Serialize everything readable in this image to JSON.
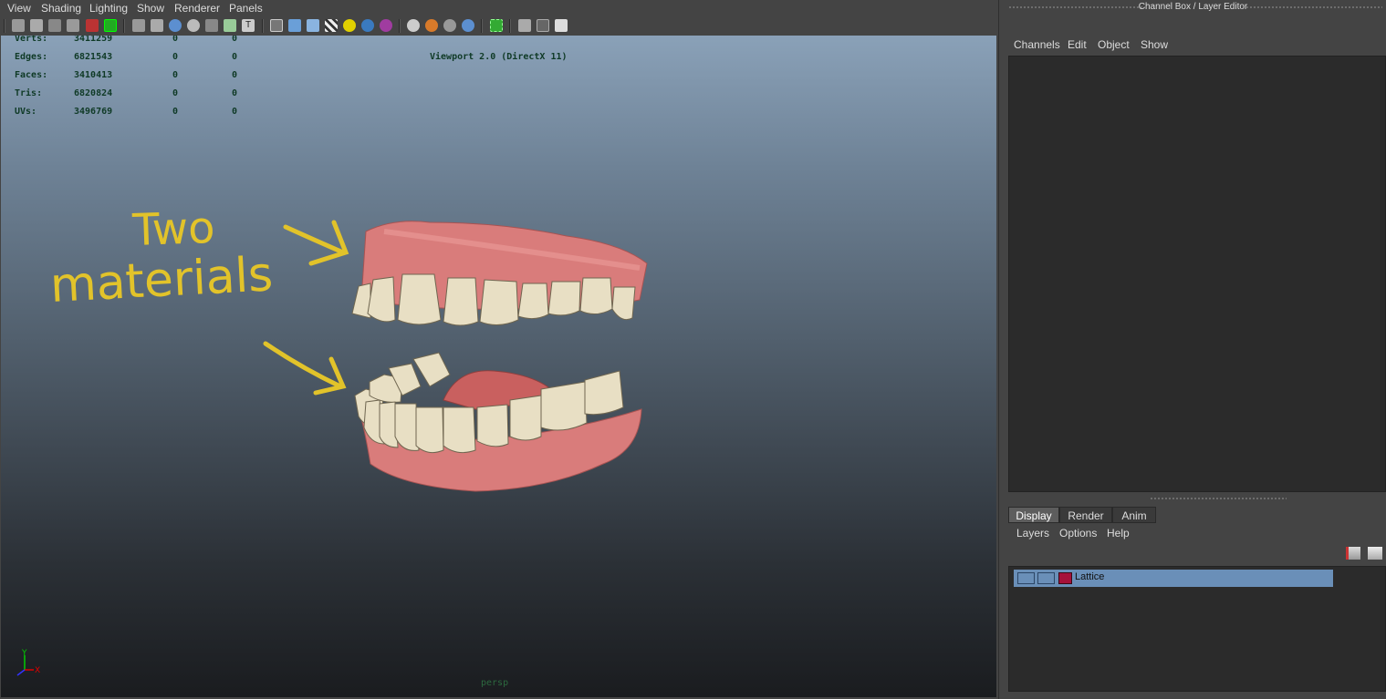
{
  "viewport_panel": {
    "menu": [
      "View",
      "Shading",
      "Lighting",
      "Show",
      "Renderer",
      "Panels"
    ],
    "hud": {
      "rows": [
        {
          "label": "Verts:",
          "v1": "3411259",
          "v2": "0",
          "v3": "0"
        },
        {
          "label": "Edges:",
          "v1": "6821543",
          "v2": "0",
          "v3": "0"
        },
        {
          "label": "Faces:",
          "v1": "3410413",
          "v2": "0",
          "v3": "0"
        },
        {
          "label": "Tris:",
          "v1": "6820824",
          "v2": "0",
          "v3": "0"
        },
        {
          "label": "UVs:",
          "v1": "3496769",
          "v2": "0",
          "v3": "0"
        }
      ]
    },
    "renderer_label": "Viewport 2.0 (DirectX 11)",
    "camera_label": "persp",
    "annotation": {
      "line1": "Two",
      "line2": "materials",
      "color": "#e2c32a"
    },
    "axis": {
      "y": "Y",
      "x": "X"
    },
    "colors": {
      "gum": "#d97c7b",
      "tooth": "#e8dfc4",
      "hud_text": "#0f3a26"
    }
  },
  "channel_box": {
    "title": "Channel Box / Layer Editor",
    "menu": [
      "Channels",
      "Edit",
      "Object",
      "Show"
    ]
  },
  "layer_editor": {
    "tabs": [
      {
        "label": "Display",
        "active": true
      },
      {
        "label": "Render",
        "active": false
      },
      {
        "label": "Anim",
        "active": false
      }
    ],
    "menu": [
      "Layers",
      "Options",
      "Help"
    ],
    "layers": [
      {
        "name": "Lattice",
        "color": "#a5113a"
      }
    ]
  }
}
